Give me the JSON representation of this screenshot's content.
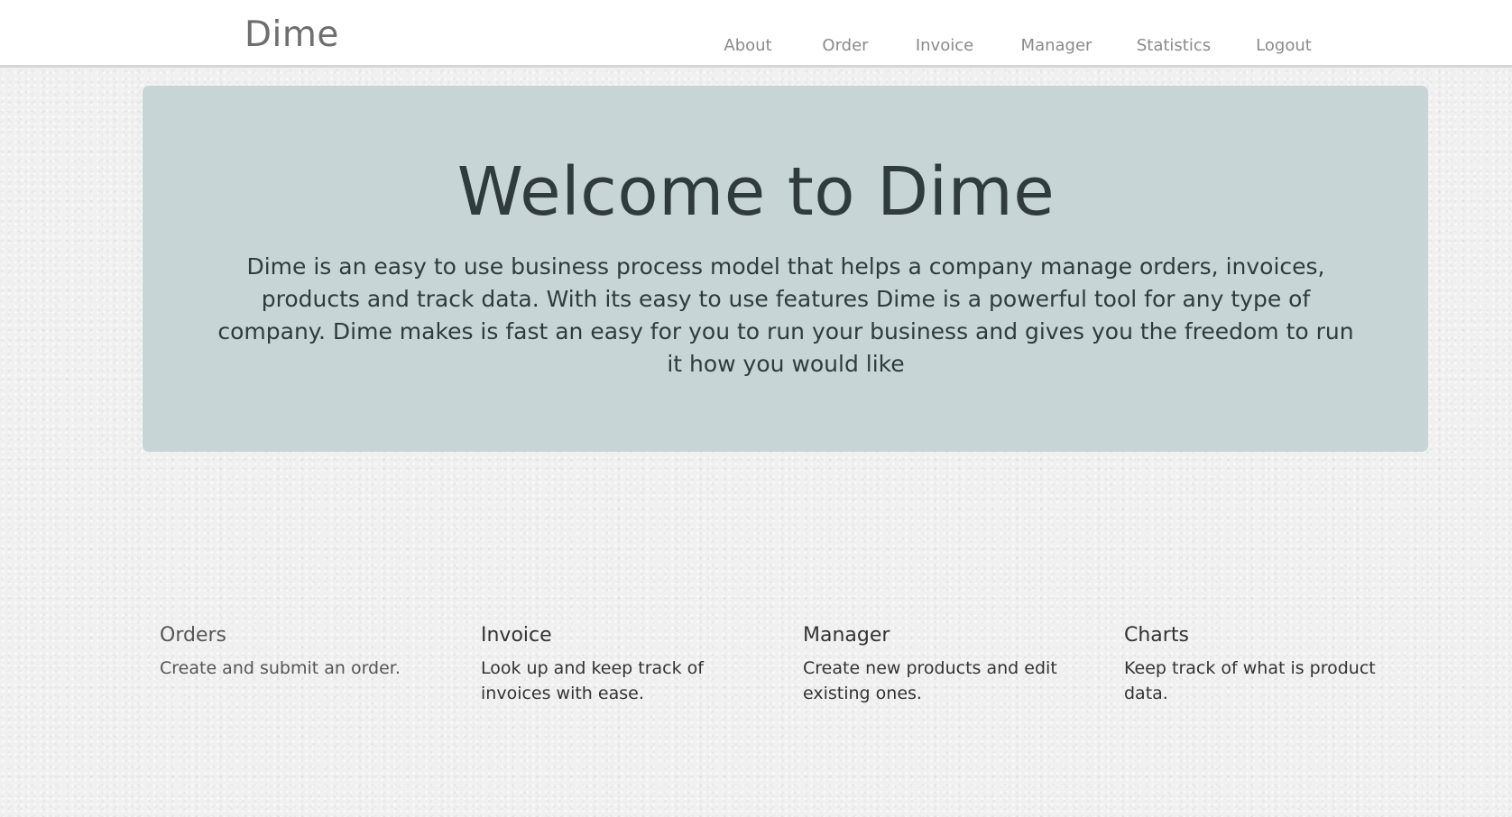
{
  "navbar": {
    "brand": "Dime",
    "links": [
      "About",
      "Order",
      "Invoice",
      "Manager",
      "Statistics",
      "Logout"
    ]
  },
  "hero": {
    "title": "Welcome to Dime",
    "text": "Dime is an easy to use business process model that helps a company manage orders, invoices, products and track data. With its easy to use features Dime is a powerful tool for any type of company. Dime makes is fast an easy for you to run your business and gives you the freedom to run it how you would like"
  },
  "features": [
    {
      "title": "Orders",
      "text": "Create and submit an order."
    },
    {
      "title": "Invoice",
      "text": "Look up and keep track of invoices with ease."
    },
    {
      "title": "Manager",
      "text": "Create new products and edit existing ones."
    },
    {
      "title": "Charts",
      "text": "Keep track of what is product data."
    }
  ],
  "colors": {
    "hero_bg": "#c8d5d6",
    "hero_text": "#2f3b3c",
    "nav_text": "#8a8a8a"
  }
}
